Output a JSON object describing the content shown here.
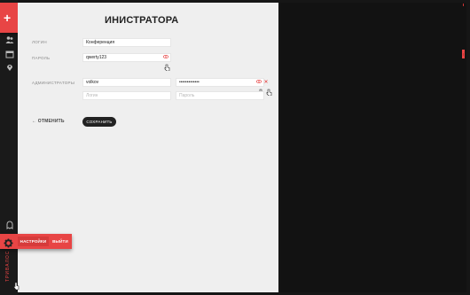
{
  "sidebar": {
    "plus_icon": "plus-icon",
    "icons": [
      "users-icon",
      "calendar-icon",
      "location-pin-icon"
    ],
    "bottom_icon": "ghost-icon",
    "brand": "ТРИВАЛОС"
  },
  "popup_menu": {
    "items": [
      {
        "name": "user-icon"
      },
      {
        "name": "calendar-icon"
      },
      {
        "name": "location-pin-icon"
      }
    ]
  },
  "page": {
    "title": "ИНИСТРАТОРА"
  },
  "form": {
    "login_label": "Логин",
    "login_value": "Конференция",
    "password_label": "Пароль",
    "password_value": "qwerty123",
    "admins_label": "Администраторы",
    "admin_login_value": "volkov",
    "admin_password_value": "•••••••••••••",
    "new_login_placeholder": "Логин",
    "new_password_placeholder": "Пароль"
  },
  "actions": {
    "cancel_label": "← ОТМЕНИТЬ",
    "save_label": "СОХРАНИТЬ"
  },
  "settings_bar": {
    "settings_label": "НАСТРОЙКИ",
    "logout_label": "ВЫЙТИ"
  },
  "colors": {
    "accent": "#e84545",
    "background": "#161616",
    "panel": "#efefef"
  }
}
